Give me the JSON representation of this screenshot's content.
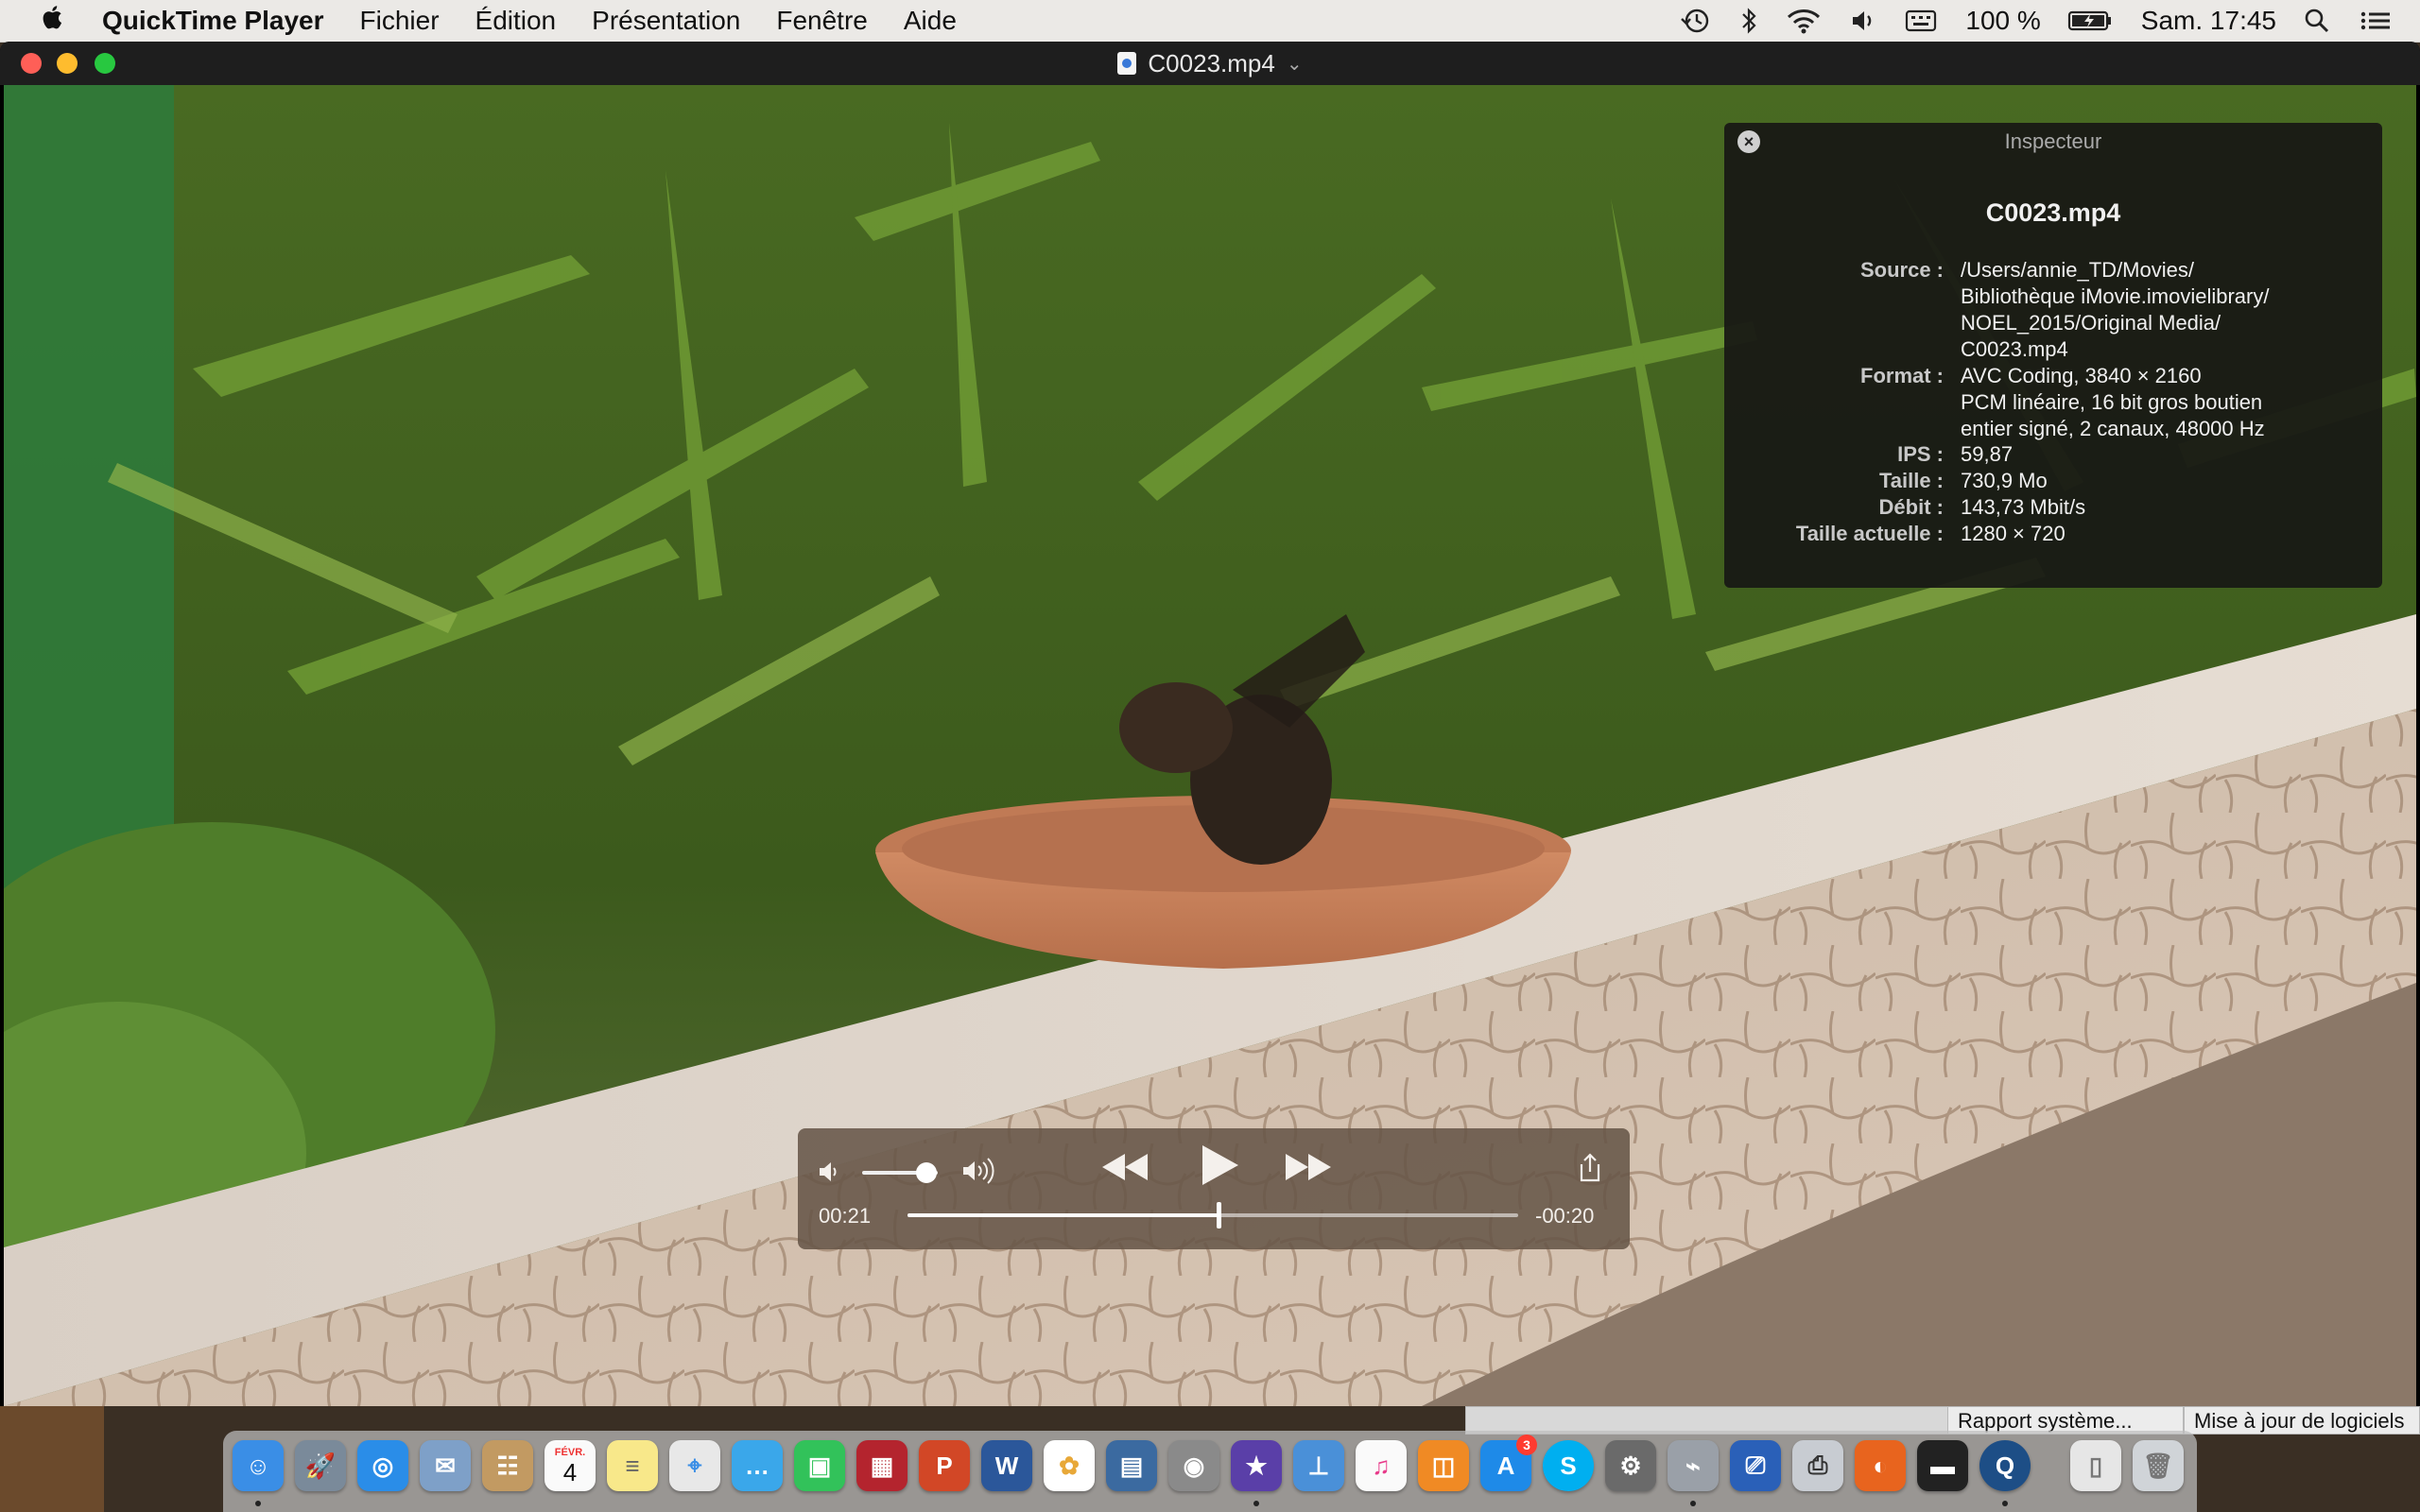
{
  "menubar": {
    "app_name": "QuickTime Player",
    "menus": [
      "Fichier",
      "Édition",
      "Présentation",
      "Fenêtre",
      "Aide"
    ],
    "battery": "100 %",
    "clock": "Sam. 17:45"
  },
  "window": {
    "title": "C0023.mp4"
  },
  "inspector": {
    "title": "Inspecteur",
    "filename": "C0023.mp4",
    "rows": [
      {
        "label": "Source :",
        "lines": [
          "/Users/annie_TD/Movies/",
          "Bibliothèque iMovie.imovielibrary/",
          "NOEL_2015/Original Media/",
          "C0023.mp4"
        ]
      },
      {
        "label": "Format :",
        "lines": [
          "AVC Coding, 3840 × 2160",
          "PCM linéaire, 16 bit gros boutien",
          "entier signé, 2 canaux, 48000 Hz"
        ]
      },
      {
        "label": "IPS :",
        "lines": [
          "59,87"
        ]
      },
      {
        "label": "Taille :",
        "lines": [
          "730,9 Mo"
        ]
      },
      {
        "label": "Débit :",
        "lines": [
          "143,73 Mbit/s"
        ]
      },
      {
        "label": "Taille actuelle :",
        "lines": [
          "1280 × 720"
        ]
      }
    ]
  },
  "player": {
    "elapsed": "00:21",
    "remaining": "-00:20",
    "progress": 0.51,
    "volume": 0.85
  },
  "background_windows": {
    "system_report": "Rapport système...",
    "software_update": "Mise à jour de logiciels"
  },
  "dock": {
    "calendar_month": "FÉVR.",
    "calendar_day": "4",
    "app_store_badge": "3"
  }
}
